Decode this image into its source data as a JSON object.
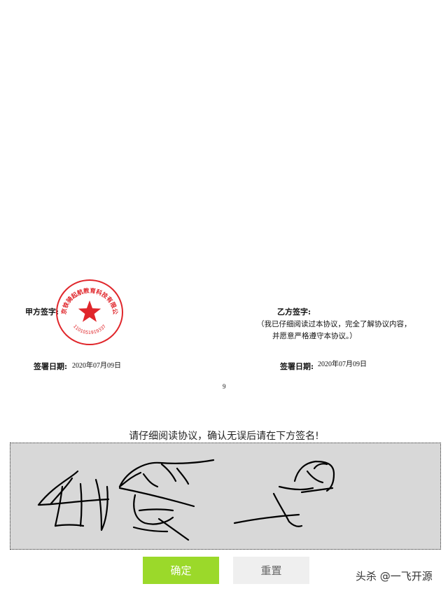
{
  "document": {
    "party_a": {
      "signature_label": "甲方签字:",
      "date_label": "签署日期:",
      "date_value": "2020年07月09日"
    },
    "seal": {
      "company_text": "北京铁骑起航教育科技有限公司",
      "number_text": "1101051919337",
      "color": "#e0262b"
    },
    "party_b": {
      "signature_label": "乙方签字:",
      "note_line1": "（我已仔细阅读过本协议，完全了解协议内容，",
      "note_line2": "并愿意严格遵守本协议。）",
      "date_label": "签署日期:",
      "date_value": "2020年07月09日"
    },
    "page_number": "9"
  },
  "signature_section": {
    "instruction": "请仔细阅读协议，确认无误后请在下方签名!",
    "pad_color": "#d8d8d8",
    "confirm_label": "确定",
    "confirm_color": "#9bd92a",
    "reset_label": "重置"
  },
  "watermark": "头杀 @一飞开源"
}
